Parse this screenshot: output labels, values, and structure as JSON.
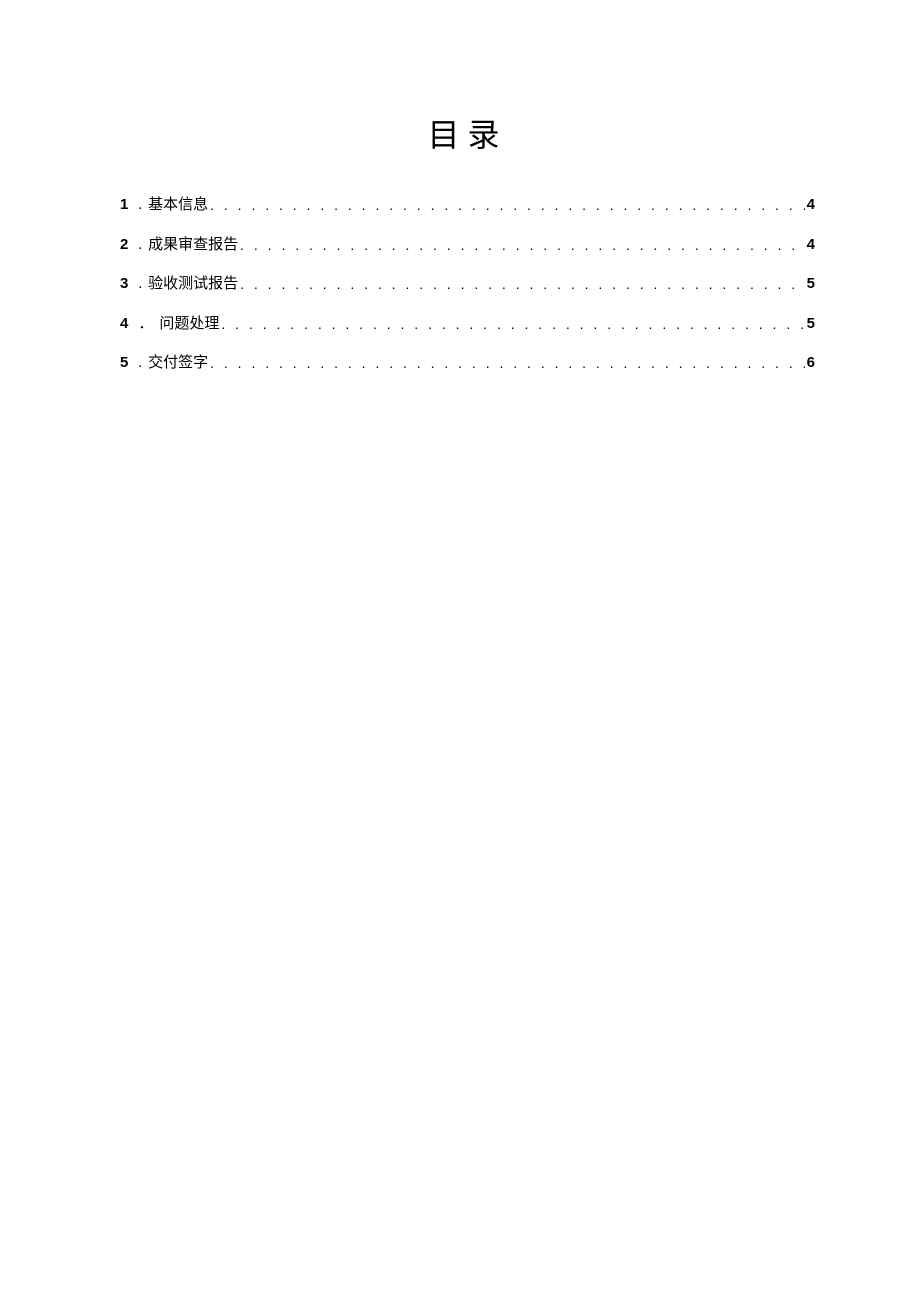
{
  "title": "目录",
  "toc": [
    {
      "number": "1",
      "sep": ".",
      "text": "基本信息",
      "page": "4"
    },
    {
      "number": "2",
      "sep": ".",
      "text": "成果审查报告",
      "page": "4"
    },
    {
      "number": "3",
      "sep": ".",
      "text": "验收测试报告",
      "page": "5"
    },
    {
      "number": "4",
      "sep": "．",
      "text": "问题处理",
      "page": "5"
    },
    {
      "number": "5",
      "sep": ".",
      "text": "交付签字",
      "page": "6"
    }
  ]
}
